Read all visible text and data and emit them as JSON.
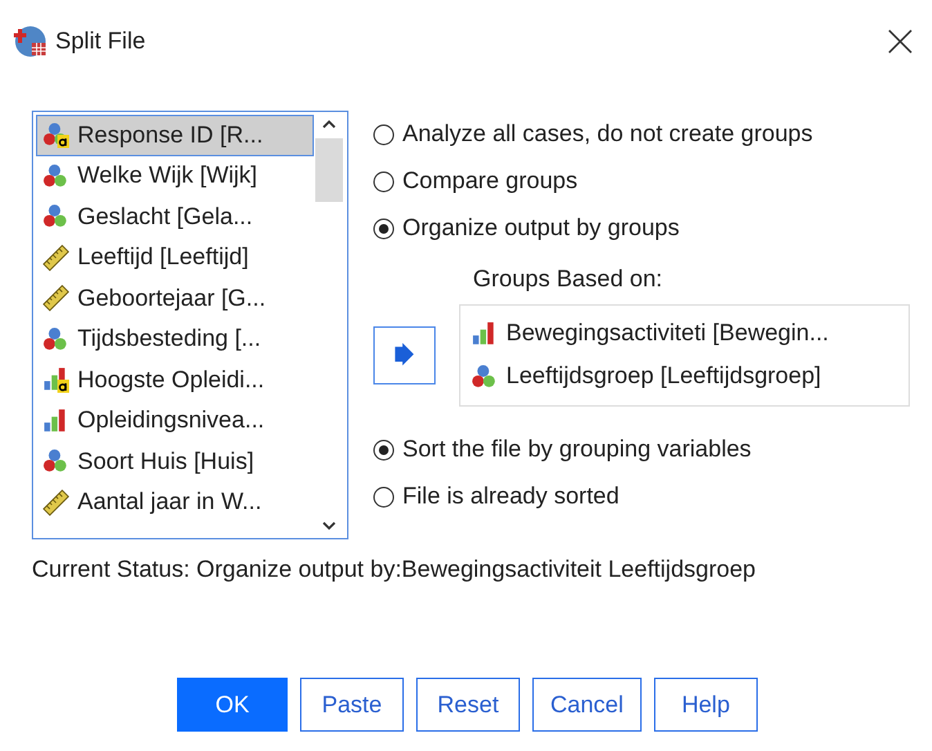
{
  "window": {
    "title": "Split File"
  },
  "variables": [
    {
      "label": "Response ID [R...",
      "kind": "nominal_string",
      "selected": true
    },
    {
      "label": "Welke Wijk [Wijk]",
      "kind": "nominal",
      "selected": false
    },
    {
      "label": "Geslacht [Gela...",
      "kind": "nominal",
      "selected": false
    },
    {
      "label": "Leeftijd [Leeftijd]",
      "kind": "scale",
      "selected": false
    },
    {
      "label": "Geboortejaar [G...",
      "kind": "scale",
      "selected": false
    },
    {
      "label": "Tijdsbesteding [...",
      "kind": "nominal",
      "selected": false
    },
    {
      "label": "Hoogste Opleidi...",
      "kind": "ordinal_string",
      "selected": false
    },
    {
      "label": "Opleidingsnivea...",
      "kind": "ordinal",
      "selected": false
    },
    {
      "label": "Soort Huis [Huis]",
      "kind": "nominal",
      "selected": false
    },
    {
      "label": "Aantal jaar in W...",
      "kind": "scale",
      "selected": false
    }
  ],
  "mode_options": [
    {
      "label": "Analyze all cases, do not create groups",
      "selected": false
    },
    {
      "label": "Compare groups",
      "selected": false
    },
    {
      "label": "Organize output by groups",
      "selected": true
    }
  ],
  "groups_based_on": {
    "label": "Groups Based on:",
    "items": [
      {
        "label": "Bewegingsactiviteti [Bewegin...",
        "kind": "ordinal"
      },
      {
        "label": "Leeftijdsgroep [Leeftijdsgroep]",
        "kind": "nominal"
      }
    ]
  },
  "sort_options": [
    {
      "label": "Sort the file by grouping variables",
      "selected": true
    },
    {
      "label": "File is already sorted",
      "selected": false
    }
  ],
  "status": "Current Status: Organize output by:Bewegingsactiviteit Leeftijdsgroep",
  "buttons": [
    {
      "label": "OK",
      "kind": "default"
    },
    {
      "label": "Paste",
      "kind": "normal"
    },
    {
      "label": "Reset",
      "kind": "normal"
    },
    {
      "label": "Cancel",
      "kind": "normal"
    },
    {
      "label": "Help",
      "kind": "normal"
    }
  ]
}
